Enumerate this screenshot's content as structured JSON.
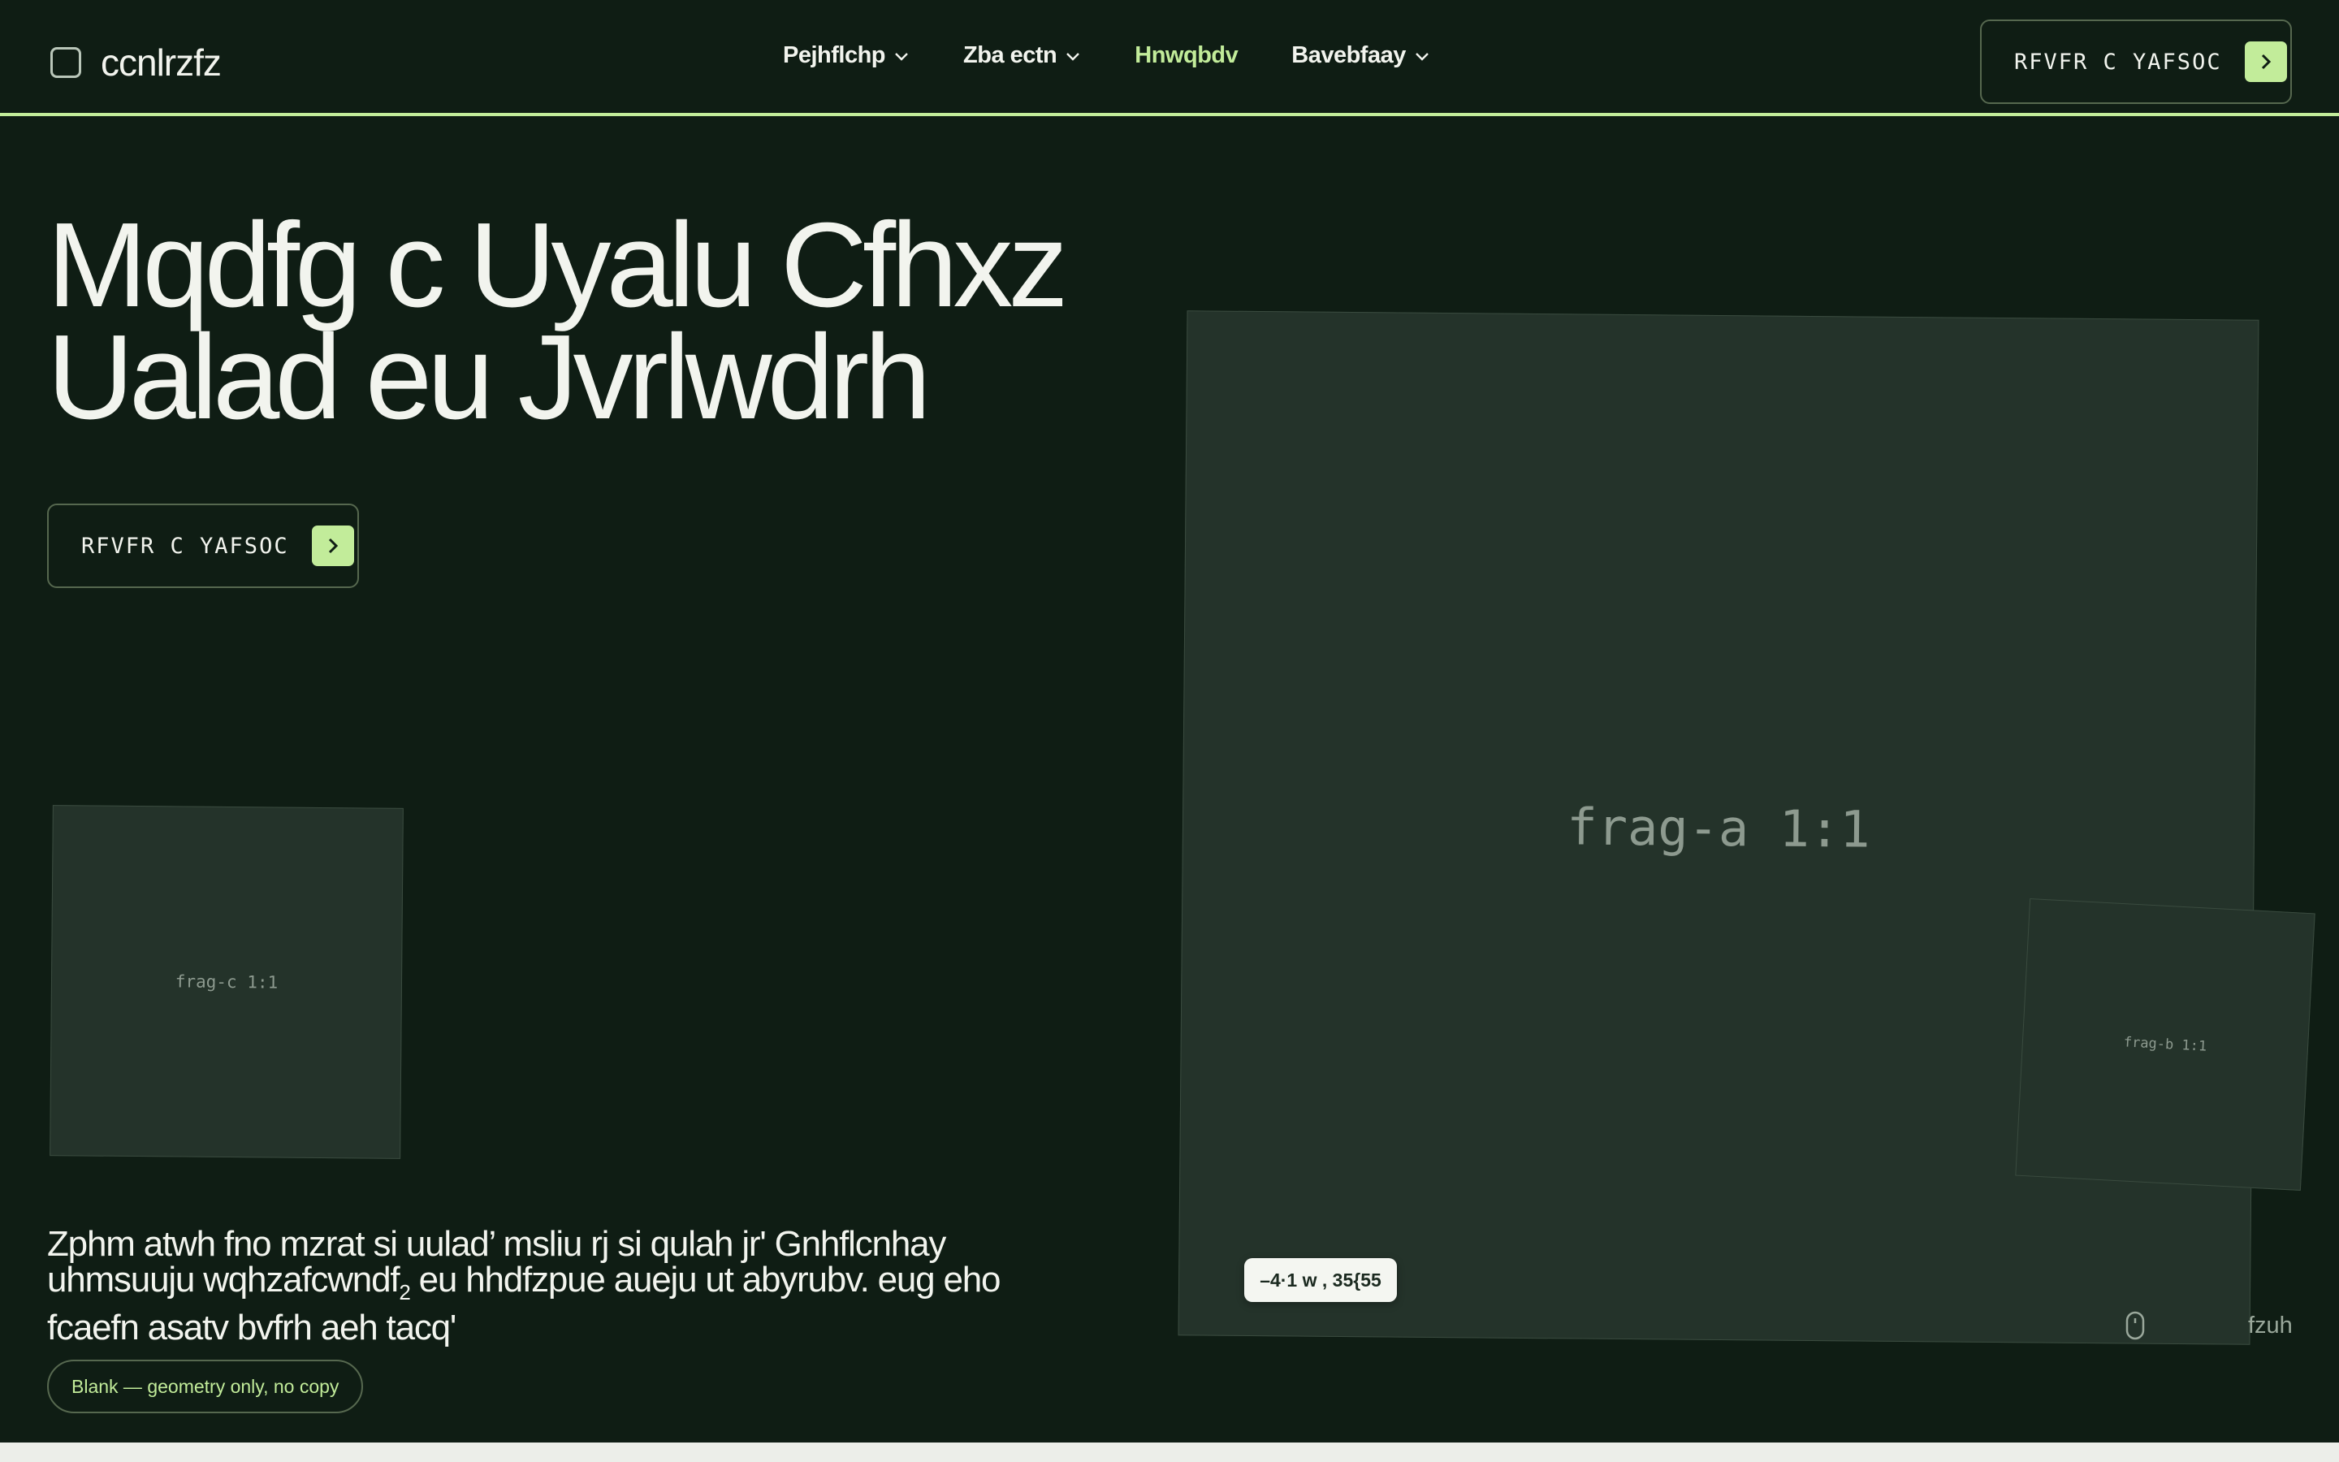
{
  "brand": {
    "name": "ccnlrzfz",
    "icon": "square-outline-icon"
  },
  "nav": {
    "items": [
      {
        "label": "Pejhflchp",
        "has_menu": true,
        "active": false
      },
      {
        "label": "Zba ectn",
        "has_menu": true,
        "active": false
      },
      {
        "label": "Hnwqbdv",
        "has_menu": false,
        "active": true
      },
      {
        "label": "Bavebfaay",
        "has_menu": true,
        "active": false
      }
    ]
  },
  "header_cta": {
    "label": "RFVFR C YAFSOC",
    "icon": "chevron-right-icon"
  },
  "hero": {
    "title_line1": "Mqdfg c Uyalu Cfhxz",
    "title_line2": "Ualad eu Jvrlwdrh",
    "cta": {
      "label": "RFVFR C YAFSOC",
      "icon": "chevron-right-icon"
    },
    "body_line1": "Zphm atwh fno mzrat si uulad’ msliu rj si qulah jr' Gnhflcnhay",
    "body_line2": "uhmsuuju wqhzafcwndf",
    "body_subscript": "2",
    "body_line2_rest": " eu hhdfzpue aueju ut abyrubv. eug eho",
    "body_line3": "fcaefn asatv bvfrh aeh tacq'"
  },
  "fragments": {
    "a": "frag-a 1:1",
    "b": "frag-b 1:1",
    "c": "frag-c 1:1"
  },
  "coords_chip": "–4·1 w , 35{55",
  "scroll": {
    "label": "fzuh",
    "icon": "mouse-icon"
  },
  "blank_pill": "Blank — geometry only, no copy",
  "colors": {
    "background": "#0f1d14",
    "accent": "#c2ec9a",
    "panel": "#24332a",
    "text": "#f2f4ee"
  }
}
